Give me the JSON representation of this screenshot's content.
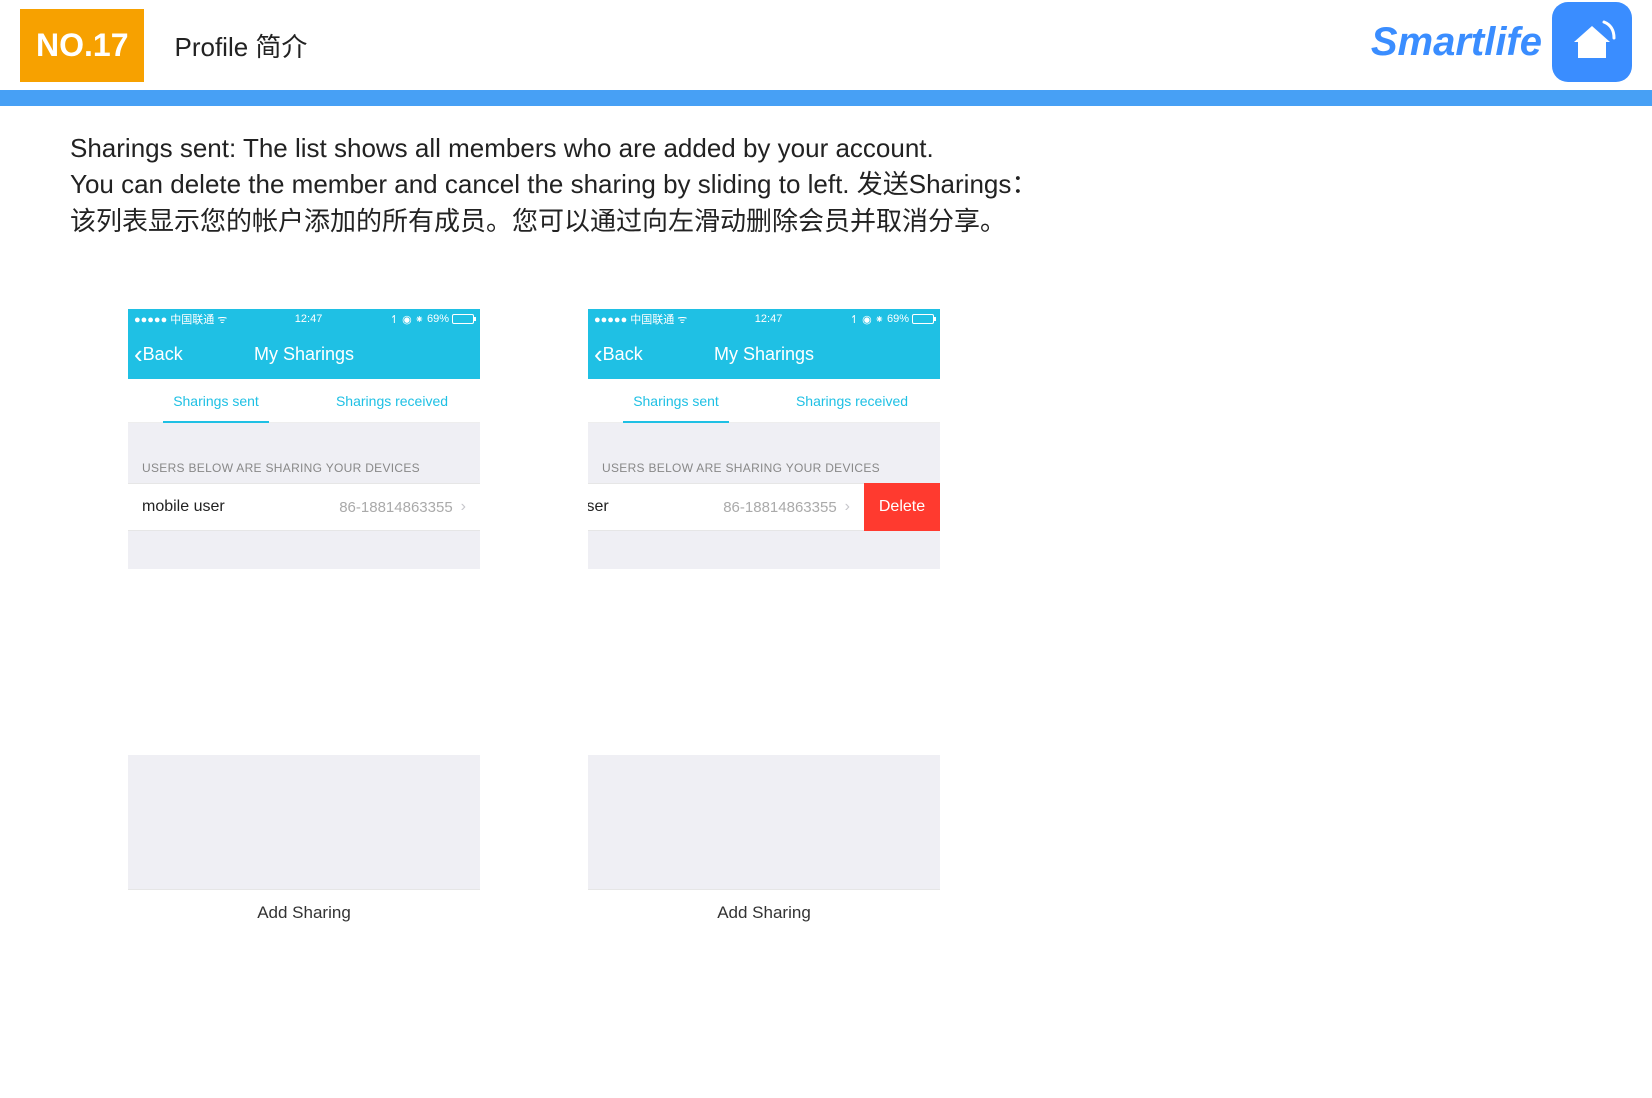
{
  "header": {
    "page_number": "NO.17",
    "title": "Profile 简介",
    "brand_name": "Smartlife"
  },
  "description": {
    "line1": "Sharings sent: The list shows all members who are added by your account.",
    "line2": "You can delete the member and cancel the sharing by sliding to left. 发送Sharings：",
    "line3": "该列表显示您的帐户添加的所有成员。您可以通过向左滑动删除会员并取消分享。"
  },
  "phone": {
    "status": {
      "carrier": "●●●●● 中国联通",
      "wifi": "ᯤ",
      "time": "12:47",
      "indicators": "↿ ◉ ⁕",
      "battery_pct": "69%"
    },
    "nav": {
      "back_label": "Back",
      "title": "My Sharings"
    },
    "tabs": {
      "sent": "Sharings sent",
      "received": "Sharings received"
    },
    "section_header": "USERS BELOW ARE SHARING YOUR DEVICES",
    "row1": {
      "user_full": "mobile user",
      "user_partial": "er",
      "phone_number": "86-18814863355"
    },
    "delete_label": "Delete",
    "add_sharing": "Add Sharing"
  }
}
